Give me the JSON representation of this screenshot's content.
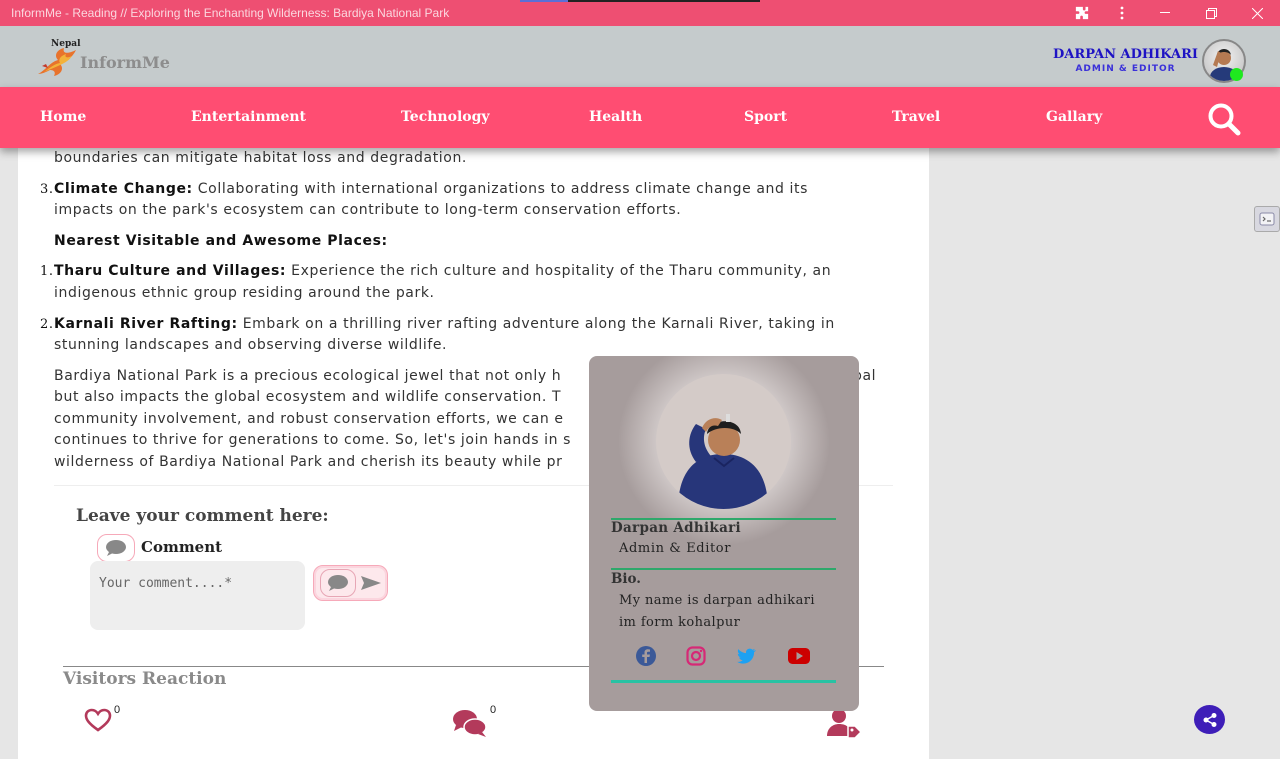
{
  "window": {
    "title": "InformMe - Reading // Exploring the Enchanting Wilderness: Bardiya National Park"
  },
  "header": {
    "logo_top": "Nepal",
    "logo_name": "InformMe",
    "user_name": "DARPAN ADHIKARI",
    "user_role": "ADMIN & EDITOR"
  },
  "nav": {
    "items": [
      "Home",
      "Entertainment",
      "Technology",
      "Health",
      "Sport",
      "Travel",
      "Gallary"
    ]
  },
  "article": {
    "line0": "boundaries can mitigate habitat loss and degradation.",
    "item3_number": "3.",
    "item3_title": "Climate Change:",
    "item3_text_a": " Collaborating with international organizations to address climate change and its",
    "item3_text_b": "impacts on the park's ecosystem can contribute to long-term conservation efforts.",
    "nearest_heading": "Nearest Visitable and Awesome Places:",
    "place1_number": "1.",
    "place1_title": "Tharu Culture and Villages:",
    "place1_text_a": " Experience the rich culture and hospitality of the Tharu community, an",
    "place1_text_b": "indigenous ethnic group residing around the park.",
    "place2_number": "2.",
    "place2_title": "Karnali River Rafting:",
    "place2_text_a": " Embark on a thrilling river rafting adventure along the Karnali River, taking in",
    "place2_text_b": "stunning landscapes and observing diverse wildlife.",
    "conclusion_1": "Bardiya National Park is a precious ecological jewel that not only h",
    "conclusion_1_end": "bal",
    "conclusion_2": "but also impacts the global ecosystem and wildlife conservation. T",
    "conclusion_3": "community involvement, and robust conservation efforts, we can e",
    "conclusion_4": "continues to thrive for generations to come. So, let's join hands in s",
    "conclusion_5": "wilderness of Bardiya National Park and cherish its beauty while pr"
  },
  "comments": {
    "heading": "Leave your comment here:",
    "label": "Comment",
    "placeholder": "Your comment....*"
  },
  "reactions": {
    "heading": "Visitors Reaction",
    "likes": "0",
    "comments": "0"
  },
  "profile_popup": {
    "name": "Darpan Adhikari",
    "role": "Admin & Editor",
    "bio_label": "Bio.",
    "bio": "My name is darpan adhikari im form kohalpur",
    "socials": [
      "facebook-icon",
      "instagram-icon",
      "twitter-icon",
      "youtube-icon"
    ]
  },
  "colors": {
    "brand_pink": "#ff4d72",
    "header_gray": "#c5cbcc",
    "user_blue": "#1e13c4",
    "popup_bg": "#a69c9c",
    "facebook": "#3b5998",
    "instagram": "#d62976",
    "twitter": "#1da1f2",
    "youtube": "#cc0000"
  }
}
